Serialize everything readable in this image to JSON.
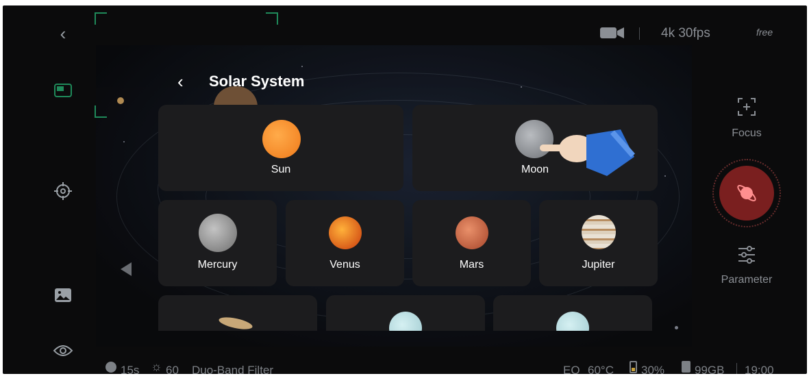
{
  "top_bar": {
    "resolution": "4k 30fps",
    "mode": "free"
  },
  "panel": {
    "title": "Solar System",
    "targets": [
      {
        "name": "Sun"
      },
      {
        "name": "Moon"
      },
      {
        "name": "Mercury"
      },
      {
        "name": "Venus"
      },
      {
        "name": "Mars"
      },
      {
        "name": "Jupiter"
      }
    ]
  },
  "right_panel": {
    "focus_label": "Focus",
    "parameter_label": "Parameter",
    "shutter_color": "#7a1f1f"
  },
  "status_bar": {
    "exposure": "15s",
    "gain": "60",
    "filter": "Duo-Band Filter",
    "eq": "EQ",
    "temperature": "60°C",
    "battery": "30%",
    "storage": "99GB",
    "time": "19:00"
  },
  "colors": {
    "accent": "#1f8a5a",
    "card_bg": "#1c1c1e"
  }
}
